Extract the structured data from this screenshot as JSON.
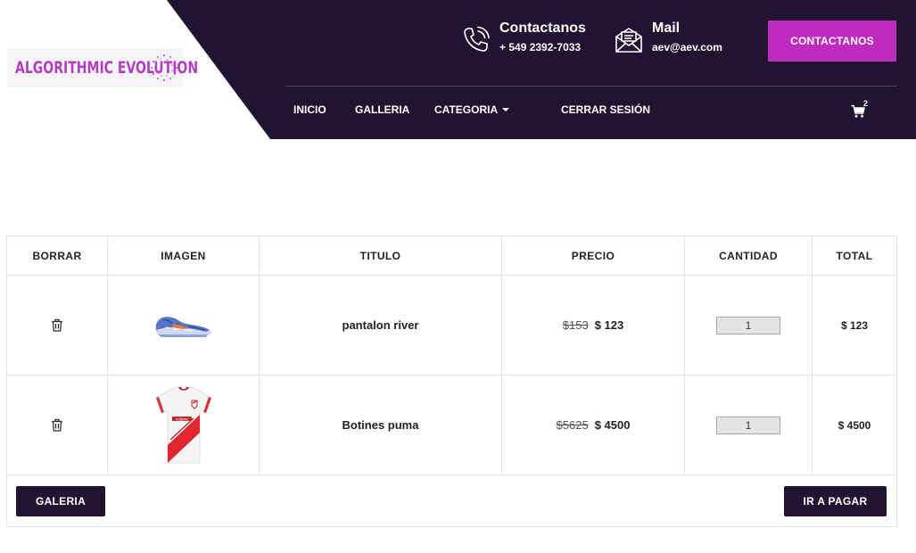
{
  "brand": {
    "logo_text": "ALGORITHMIC EVOLUTION"
  },
  "header": {
    "phone": {
      "title": "Contactanos",
      "value": "+ 549 2392-7033"
    },
    "mail": {
      "title": "Mail",
      "value": "aev@aev.com"
    },
    "cta_label": "CONTACTANOS",
    "nav": [
      {
        "label": "INICIO"
      },
      {
        "label": "GALLERIA"
      },
      {
        "label": "CATEGORIA"
      },
      {
        "label": "CERRAR SESIÓN"
      }
    ],
    "cart_count": "2"
  },
  "colors": {
    "header_bg": "#211431",
    "accent": "#c02bbf",
    "button_dark": "#211431"
  },
  "cart": {
    "columns": [
      "BORRAR",
      "IMAGEN",
      "TITULO",
      "PRECIO",
      "CANTIDAD",
      "TOTAL"
    ],
    "items": [
      {
        "image": "football-boot-image",
        "title": "pantalon river",
        "old_price": "$153",
        "price": "$ 123",
        "quantity": "1",
        "total": "$ 123"
      },
      {
        "image": "river-jersey-image",
        "title": "Botines puma",
        "old_price": "$5625",
        "price": "$ 4500",
        "quantity": "1",
        "total": "$ 4500"
      }
    ],
    "gallery_button": "GALERIA",
    "pay_button": "IR A PAGAR"
  }
}
